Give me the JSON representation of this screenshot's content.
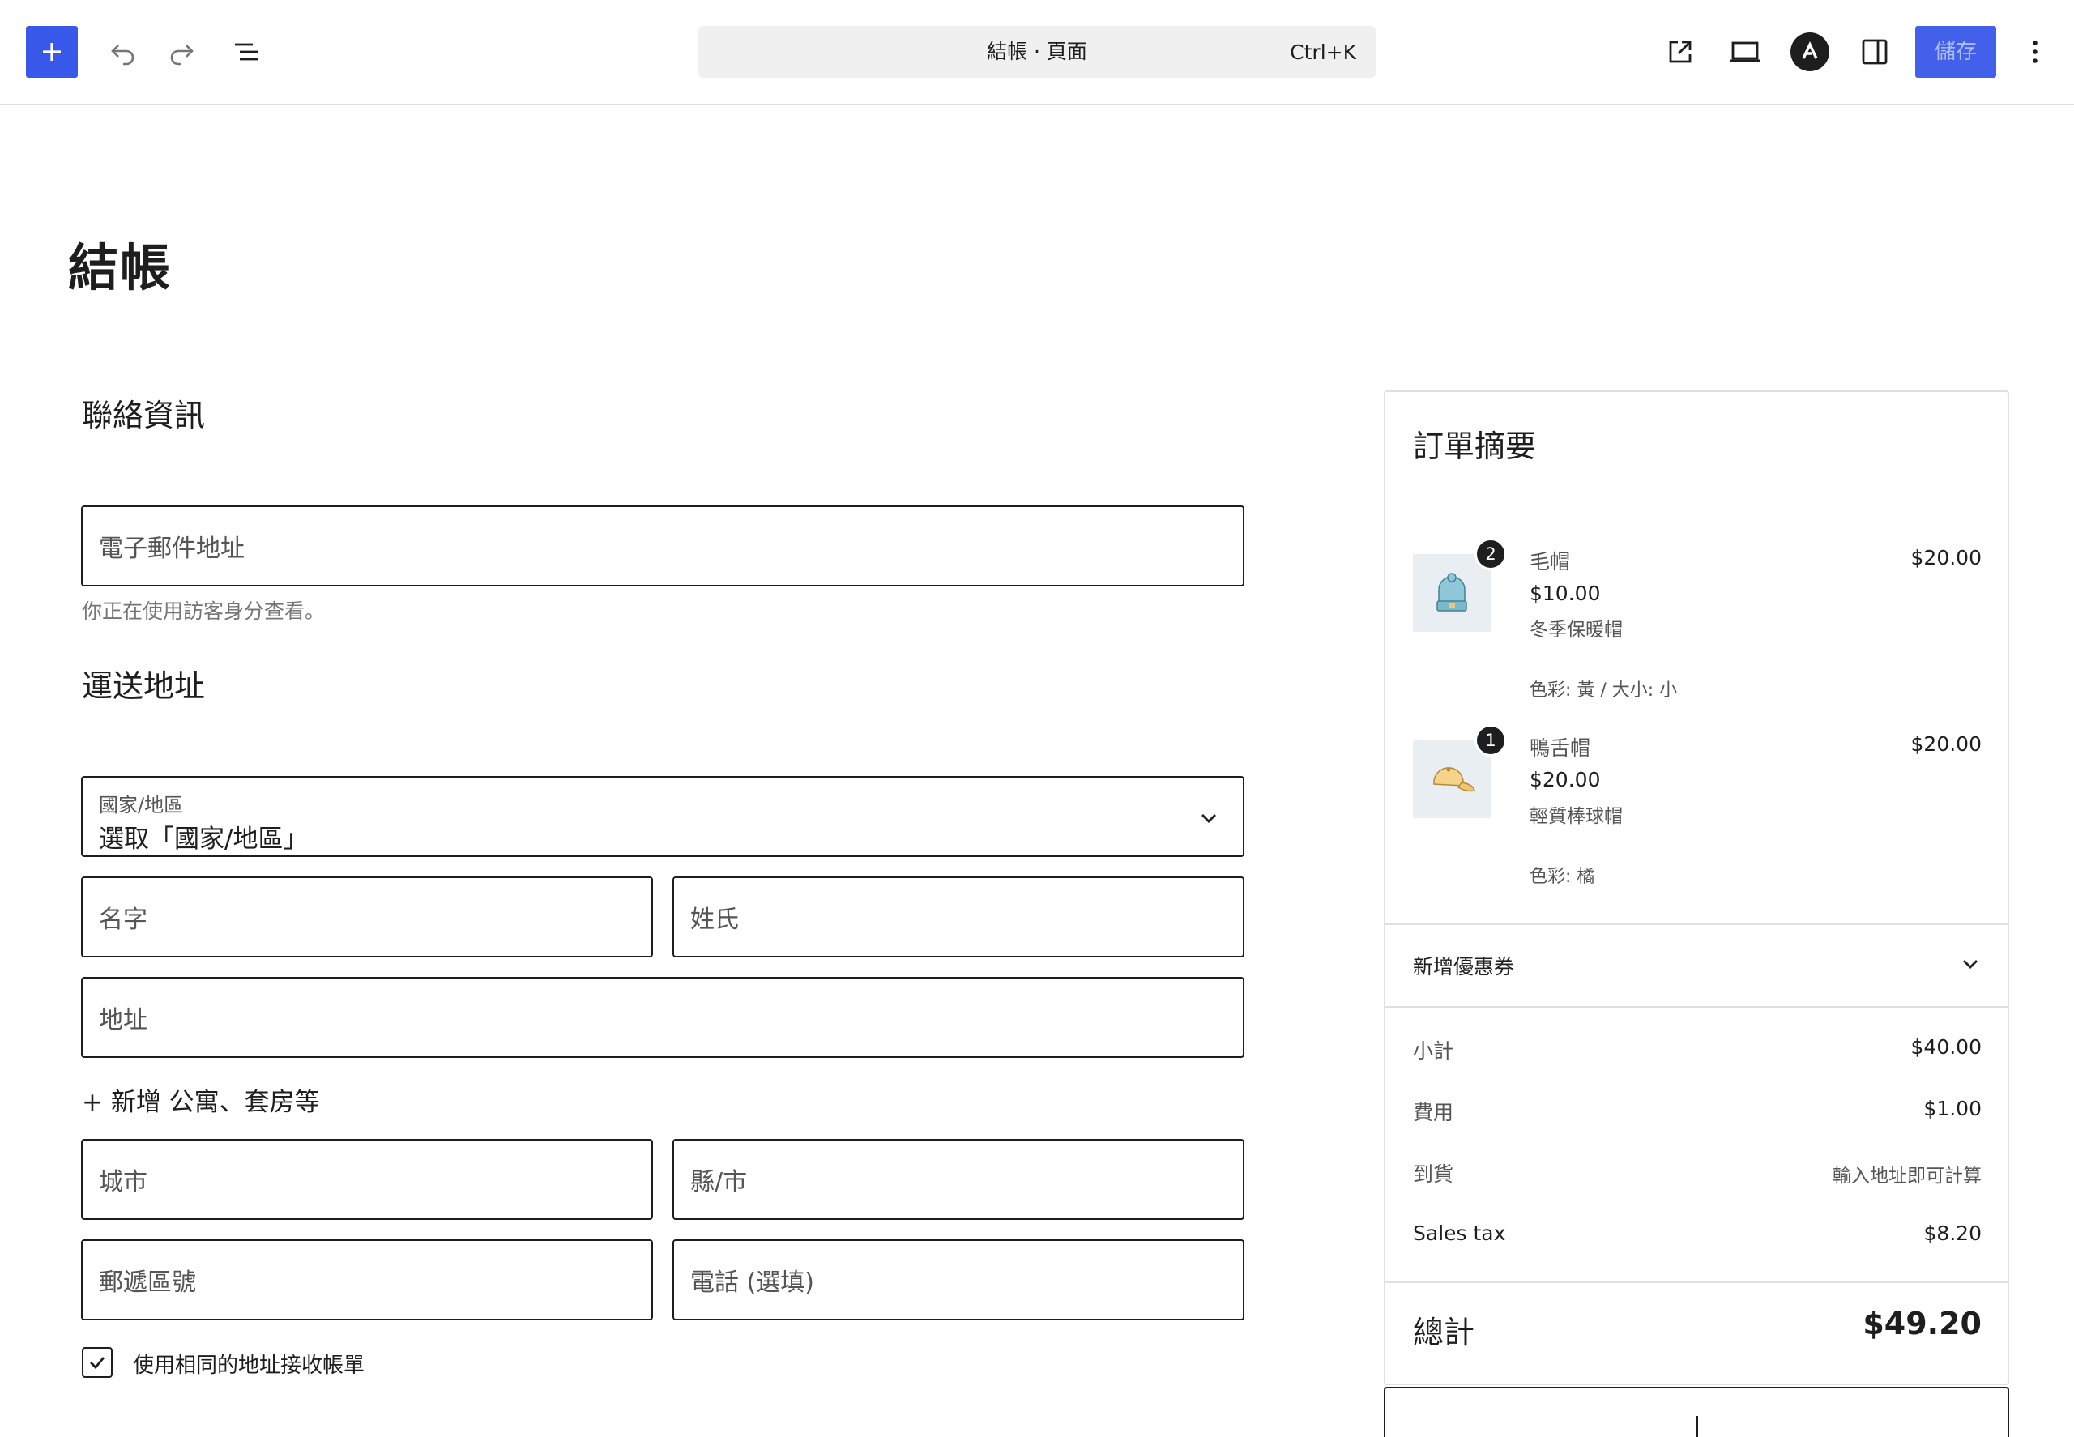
{
  "toolbar": {
    "add_label": "+",
    "document_title": "結帳 · 頁面",
    "shortcut": "Ctrl+K",
    "save_label": "儲存"
  },
  "page": {
    "title": "結帳"
  },
  "contact": {
    "heading": "聯絡資訊",
    "email_placeholder": "電子郵件地址",
    "guest_note": "你正在使用訪客身分查看。"
  },
  "shipping": {
    "heading": "運送地址",
    "country_label": "國家/地區",
    "country_value": "選取「國家/地區」",
    "first_name": "名字",
    "last_name": "姓氏",
    "address": "地址",
    "add_apartment": "+ 新增 公寓、套房等",
    "city": "城市",
    "county": "縣/市",
    "postcode": "郵遞區號",
    "phone": "電話 (選填)",
    "same_billing": "使用相同的地址接收帳單"
  },
  "summary": {
    "title": "訂單摘要",
    "items": [
      {
        "qty": "2",
        "name": "毛帽",
        "price": "$10.00",
        "description": "冬季保暖帽",
        "attributes": "色彩: 黃 / 大小: 小",
        "total": "$20.00",
        "icon": "beanie-icon"
      },
      {
        "qty": "1",
        "name": "鴨舌帽",
        "price": "$20.00",
        "description": "輕質棒球帽",
        "attributes": "色彩: 橘",
        "total": "$20.00",
        "icon": "cap-icon"
      }
    ],
    "coupon_label": "新增優惠券",
    "subtotal_label": "小計",
    "subtotal_value": "$40.00",
    "fees_label": "費用",
    "fees_value": "$1.00",
    "shipping_label": "到貨",
    "shipping_value": "輸入地址即可計算",
    "tax_label": "Sales tax",
    "tax_value": "$8.20",
    "total_label": "總計",
    "total_value": "$49.20"
  },
  "colors": {
    "accent": "#3858e9",
    "text": "#1e1e1e",
    "muted": "#757575",
    "border": "#e0e0e0"
  }
}
